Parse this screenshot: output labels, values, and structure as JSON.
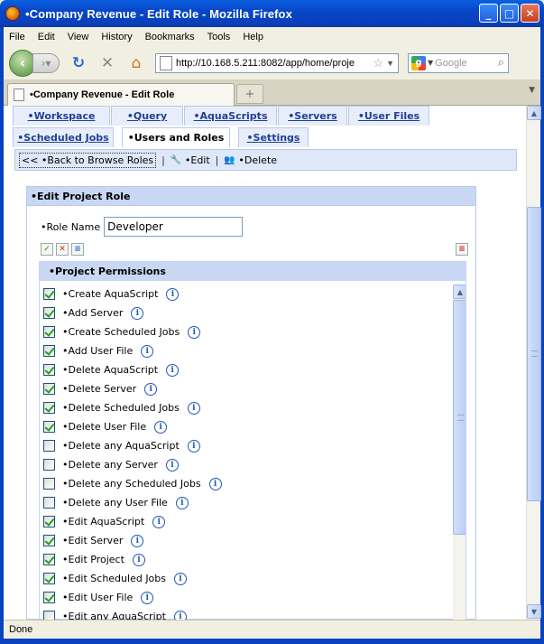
{
  "window": {
    "title": "•Company Revenue - Edit Role - Mozilla Firefox"
  },
  "menu": [
    "File",
    "Edit",
    "View",
    "History",
    "Bookmarks",
    "Tools",
    "Help"
  ],
  "browser": {
    "url": "http://10.168.5.211:8082/app/home/proje",
    "search_placeholder": "Google",
    "tab_title": "•Company Revenue - Edit Role",
    "new_tab": "+",
    "status": "Done"
  },
  "app_tabs_row1": [
    "•Workspace",
    "•Query",
    "•AquaScripts",
    "•Servers",
    "•User Files"
  ],
  "app_tabs_row2": [
    "•Scheduled Jobs",
    "•Users and Roles",
    "•Settings"
  ],
  "active_tab": "•Users and Roles",
  "toolbar": {
    "back": "<< •Back to Browse Roles",
    "edit": "•Edit",
    "delete": "•Delete",
    "sep": "|"
  },
  "panel": {
    "title": "•Edit Project Role",
    "role_name_label": "•Role Name",
    "role_name_value": "Developer",
    "permissions_title": "•Project Permissions"
  },
  "permissions": [
    {
      "label": "•Create AquaScript",
      "checked": true
    },
    {
      "label": "•Add Server",
      "checked": true
    },
    {
      "label": "•Create Scheduled Jobs",
      "checked": true
    },
    {
      "label": "•Add User File",
      "checked": true
    },
    {
      "label": "•Delete AquaScript",
      "checked": true
    },
    {
      "label": "•Delete Server",
      "checked": true
    },
    {
      "label": "•Delete Scheduled Jobs",
      "checked": true
    },
    {
      "label": "•Delete User File",
      "checked": true
    },
    {
      "label": "•Delete any AquaScript",
      "checked": false
    },
    {
      "label": "•Delete any Server",
      "checked": false
    },
    {
      "label": "•Delete any Scheduled Jobs",
      "checked": false
    },
    {
      "label": "•Delete any User File",
      "checked": false
    },
    {
      "label": "•Edit AquaScript",
      "checked": true
    },
    {
      "label": "•Edit Server",
      "checked": true
    },
    {
      "label": "•Edit Project",
      "checked": true
    },
    {
      "label": "•Edit Scheduled Jobs",
      "checked": true
    },
    {
      "label": "•Edit User File",
      "checked": true
    },
    {
      "label": "•Edit any AquaScript",
      "checked": false
    }
  ]
}
